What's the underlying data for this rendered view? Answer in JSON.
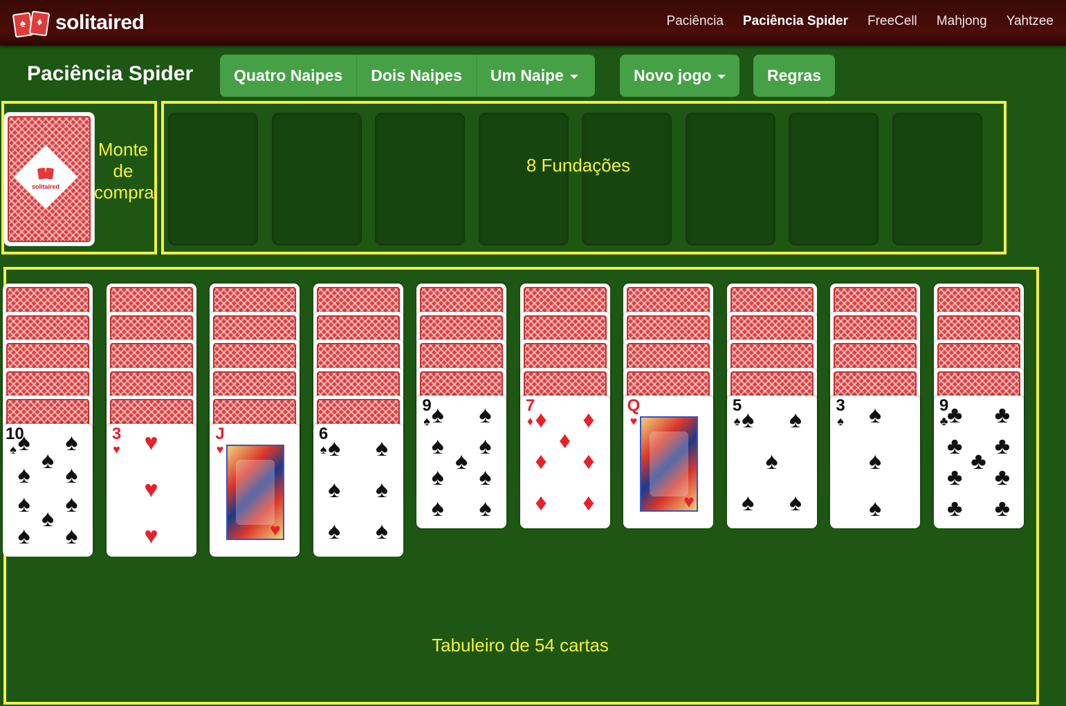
{
  "brand": {
    "name": "solitaired",
    "logo_icon": "cards-logo-icon"
  },
  "nav": {
    "links": [
      {
        "label": "Paciência",
        "active": false
      },
      {
        "label": "Paciência Spider",
        "active": true
      },
      {
        "label": "FreeCell",
        "active": false
      },
      {
        "label": "Mahjong",
        "active": false
      },
      {
        "label": "Yahtzee",
        "active": false
      }
    ]
  },
  "header": {
    "title": "Paciência Spider",
    "suit_buttons": [
      "Quatro Naipes",
      "Dois Naipes",
      "Um Naipe"
    ],
    "new_game": "Novo jogo",
    "rules": "Regras"
  },
  "annotations": {
    "draw_pile": "Monte de compra",
    "foundations": "8 Fundações",
    "tableau": "Tabuleiro de 54 cartas",
    "color": "#f5f23a"
  },
  "colors": {
    "felt": "#1e5614",
    "navbar": "#4a0d08",
    "button": "#46a046",
    "card_back": "#e04040"
  },
  "foundations": {
    "count": 8
  },
  "tableau": {
    "columns": [
      {
        "face_down": 5,
        "face_up": {
          "rank": "10",
          "suit": "♠",
          "color": "black"
        }
      },
      {
        "face_down": 5,
        "face_up": {
          "rank": "3",
          "suit": "♥",
          "color": "red"
        }
      },
      {
        "face_down": 5,
        "face_up": {
          "rank": "J",
          "suit": "♥",
          "color": "red"
        }
      },
      {
        "face_down": 5,
        "face_up": {
          "rank": "6",
          "suit": "♠",
          "color": "black"
        }
      },
      {
        "face_down": 4,
        "face_up": {
          "rank": "9",
          "suit": "♠",
          "color": "black"
        }
      },
      {
        "face_down": 4,
        "face_up": {
          "rank": "7",
          "suit": "♦",
          "color": "red"
        }
      },
      {
        "face_down": 4,
        "face_up": {
          "rank": "Q",
          "suit": "♥",
          "color": "red"
        }
      },
      {
        "face_down": 4,
        "face_up": {
          "rank": "5",
          "suit": "♠",
          "color": "black"
        }
      },
      {
        "face_down": 4,
        "face_up": {
          "rank": "3",
          "suit": "♠",
          "color": "black"
        }
      },
      {
        "face_down": 4,
        "face_up": {
          "rank": "9",
          "suit": "♣",
          "color": "black"
        }
      }
    ]
  }
}
